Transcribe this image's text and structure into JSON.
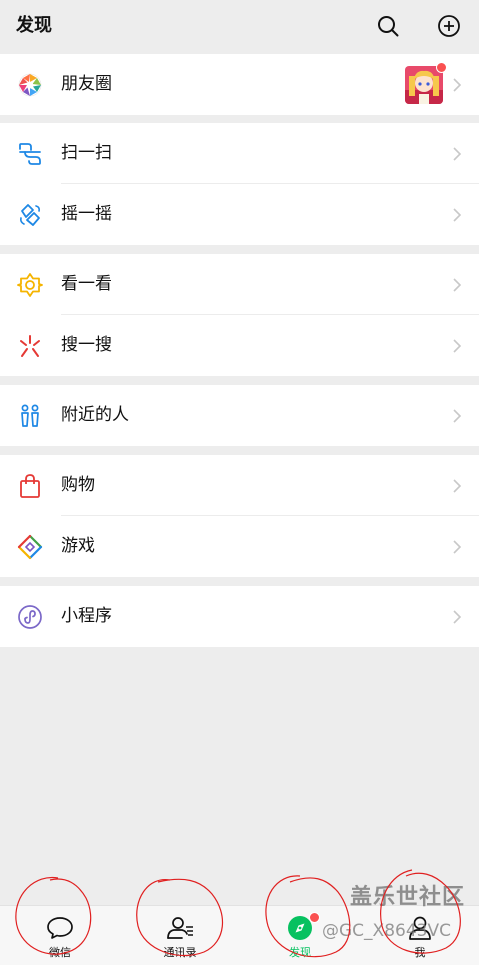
{
  "header": {
    "title": "发现",
    "search_icon": "search-icon",
    "add_icon": "plus-circle-icon"
  },
  "menu": {
    "moments": {
      "label": "朋友圈",
      "icon": "moments-aperture-icon"
    },
    "scan": {
      "label": "扫一扫",
      "icon": "scan-icon"
    },
    "shake": {
      "label": "摇一摇",
      "icon": "shake-icon"
    },
    "top_stories": {
      "label": "看一看",
      "icon": "top-stories-icon"
    },
    "search": {
      "label": "搜一搜",
      "icon": "search-sparkle-icon"
    },
    "nearby": {
      "label": "附近的人",
      "icon": "people-nearby-icon"
    },
    "shopping": {
      "label": "购物",
      "icon": "shopping-bag-icon"
    },
    "games": {
      "label": "游戏",
      "icon": "games-icon"
    },
    "mini_programs": {
      "label": "小程序",
      "icon": "mini-program-icon"
    }
  },
  "tabbar": {
    "chats": {
      "label": "微信",
      "icon": "chat-bubble-icon"
    },
    "contacts": {
      "label": "通讯录",
      "icon": "contacts-icon"
    },
    "discover": {
      "label": "发现",
      "icon": "compass-icon",
      "active": true
    },
    "me": {
      "label": "我",
      "icon": "person-icon"
    }
  },
  "watermark": {
    "line1": "盖乐世社区",
    "line2": "@GC_X8643VC"
  },
  "colors": {
    "accent": "#07c160",
    "badge": "#fa5151",
    "background": "#ededed",
    "annotation": "#e02020"
  }
}
